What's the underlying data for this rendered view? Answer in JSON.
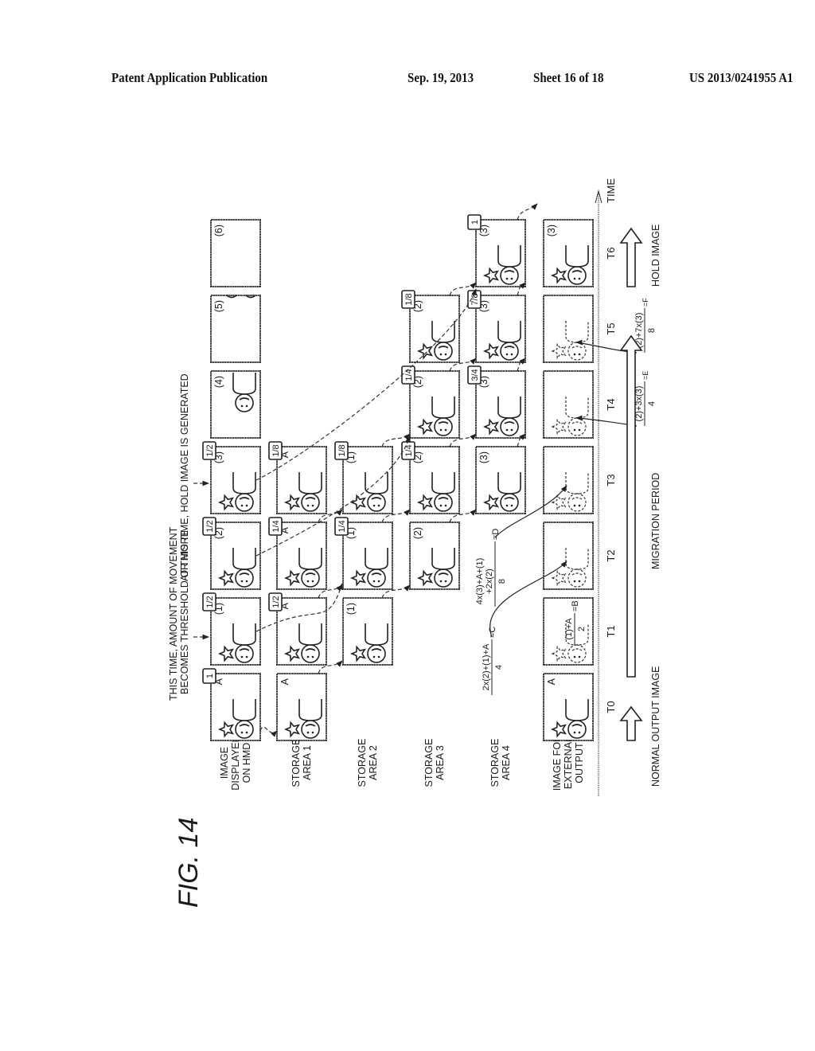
{
  "header": {
    "publication": "Patent Application Publication",
    "date": "Sep. 19, 2013",
    "sheet": "Sheet 16 of 18",
    "doc_number": "US 2013/0241955 A1"
  },
  "figure": {
    "title": "FIG. 14",
    "annotations": {
      "threshold_line1": "THIS TIME, AMOUNT OF MOVEMENT",
      "threshold_line2": "BECOMES THRESHOLD OR MORE",
      "hold": "AT THIS TIME, HOLD IMAGE IS GENERATED"
    },
    "rows": [
      {
        "id": "hmd",
        "label_lines": [
          "IMAGE",
          "DISPLAYED",
          "ON HMD"
        ]
      },
      {
        "id": "sa1",
        "label_lines": [
          "STORAGE",
          "AREA 1"
        ]
      },
      {
        "id": "sa2",
        "label_lines": [
          "STORAGE",
          "AREA 2"
        ]
      },
      {
        "id": "sa3",
        "label_lines": [
          "STORAGE",
          "AREA 3"
        ]
      },
      {
        "id": "sa4",
        "label_lines": [
          "STORAGE",
          "AREA 4"
        ]
      },
      {
        "id": "ext",
        "label_lines": [
          "IMAGE FOR",
          "EXTERNAL",
          "OUTPUT"
        ]
      }
    ],
    "time_labels": [
      "T0",
      "T1",
      "T2",
      "T3",
      "T4",
      "T5",
      "T6"
    ],
    "time_axis_label": "TIME",
    "cells": {
      "hmd": [
        {
          "t": 0,
          "tag": "A",
          "badge": "1",
          "figure": "solid"
        },
        {
          "t": 1,
          "tag": "(1)",
          "badge": "1/2",
          "figure": "solid"
        },
        {
          "t": 2,
          "tag": "(2)",
          "badge": "1/2",
          "figure": "solid"
        },
        {
          "t": 3,
          "tag": "(3)",
          "badge": "1/2",
          "figure": "solid"
        },
        {
          "t": 4,
          "tag": "(4)",
          "badge": "",
          "figure": "partial"
        },
        {
          "t": 5,
          "tag": "(5)",
          "badge": "",
          "figure": "edge"
        },
        {
          "t": 6,
          "tag": "(6)",
          "badge": "",
          "figure": "none"
        }
      ],
      "sa1": [
        {
          "t": 0,
          "tag": "A",
          "badge": "",
          "figure": "solid"
        },
        {
          "t": 1,
          "tag": "A",
          "badge": "1/2",
          "figure": "solid"
        },
        {
          "t": 2,
          "tag": "A",
          "badge": "1/4",
          "figure": "solid"
        },
        {
          "t": 3,
          "tag": "A",
          "badge": "1/8",
          "figure": "solid"
        }
      ],
      "sa2": [
        {
          "t": 1,
          "tag": "(1)",
          "badge": "",
          "figure": "solid"
        },
        {
          "t": 2,
          "tag": "(1)",
          "badge": "1/4",
          "figure": "solid"
        },
        {
          "t": 3,
          "tag": "(1)",
          "badge": "1/8",
          "figure": "solid"
        }
      ],
      "sa3": [
        {
          "t": 2,
          "tag": "(2)",
          "badge": "",
          "figure": "solid"
        },
        {
          "t": 3,
          "tag": "(2)",
          "badge": "1/4",
          "figure": "solid"
        },
        {
          "t": 4,
          "tag": "(2)",
          "badge": "1/4",
          "figure": "solid"
        },
        {
          "t": 5,
          "tag": "(2)",
          "badge": "1/8",
          "figure": "solid"
        }
      ],
      "sa4": [
        {
          "t": 3,
          "tag": "(3)",
          "badge": "",
          "figure": "solid"
        },
        {
          "t": 4,
          "tag": "(3)",
          "badge": "3/4",
          "figure": "solid"
        },
        {
          "t": 5,
          "tag": "(3)",
          "badge": "7/8",
          "figure": "solid"
        },
        {
          "t": 6,
          "tag": "(3)",
          "badge": "1",
          "figure": "solid"
        }
      ],
      "ext": [
        {
          "t": 0,
          "tag": "A",
          "badge": "",
          "figure": "solid"
        },
        {
          "t": 1,
          "tag": "",
          "badge": "",
          "figure": "ghost"
        },
        {
          "t": 2,
          "tag": "",
          "badge": "",
          "figure": "ghost"
        },
        {
          "t": 3,
          "tag": "",
          "badge": "",
          "figure": "ghost"
        },
        {
          "t": 4,
          "tag": "",
          "badge": "",
          "figure": "ghost"
        },
        {
          "t": 5,
          "tag": "",
          "badge": "",
          "figure": "ghost"
        },
        {
          "t": 6,
          "tag": "(3)",
          "badge": "",
          "figure": "solid"
        }
      ]
    },
    "formulas": {
      "B": {
        "numerator": "(1)+A",
        "denominator": "2",
        "result": "=B"
      },
      "C": {
        "numerator": "2x(2)+(1)+A",
        "denominator": "4",
        "result": "=C"
      },
      "D": {
        "numerator_line1": "4x(3)+A+(1)",
        "numerator_line2": "+2x(2)",
        "denominator": "8",
        "result": "=D"
      },
      "E": {
        "numerator": "(2)+3x(3)",
        "denominator": "4",
        "result": "=E"
      },
      "F": {
        "numerator": "(2)+7x(3)",
        "denominator": "8",
        "result": "=F"
      }
    },
    "periods": {
      "normal": "NORMAL OUTPUT IMAGE",
      "migration": "MIGRATION PERIOD",
      "hold": "HOLD IMAGE"
    }
  }
}
